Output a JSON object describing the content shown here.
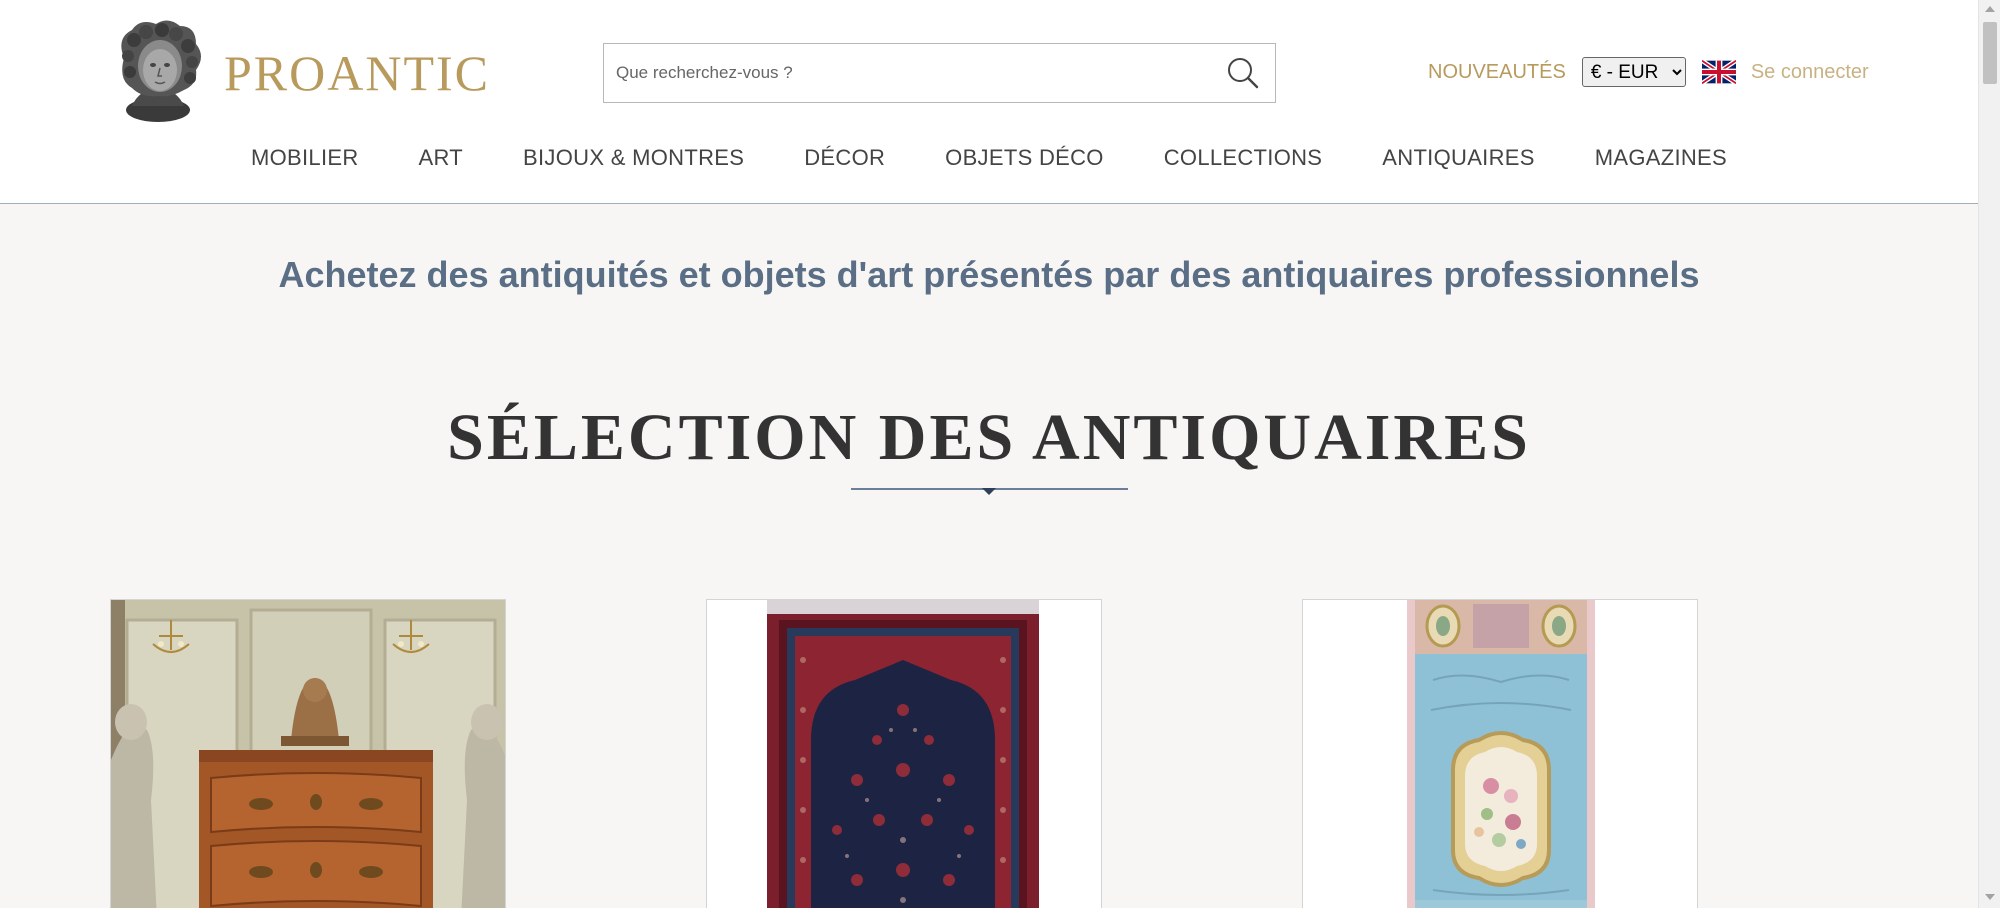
{
  "header": {
    "logo_text": "PROANTIC",
    "search": {
      "placeholder": "Que recherchez-vous ?"
    },
    "nouveautes_label": "NOUVEAUTÉS",
    "currency_selected": "€ - EUR",
    "language_icon": "uk-flag-icon",
    "login_label": "Se connecter"
  },
  "nav": {
    "items": [
      {
        "label": "MOBILIER"
      },
      {
        "label": "ART"
      },
      {
        "label": "BIJOUX & MONTRES"
      },
      {
        "label": "DÉCOR"
      },
      {
        "label": "OBJETS DÉCO"
      },
      {
        "label": "COLLECTIONS"
      },
      {
        "label": "ANTIQUAIRES"
      },
      {
        "label": "MAGAZINES"
      }
    ]
  },
  "main": {
    "tagline": "Achetez des antiquités et objets d'art présentés par des antiquaires professionnels",
    "section_title": "SÉLECTION DES ANTIQUAIRES",
    "cards": [
      {
        "image": "commode-with-cherub-statues-photo"
      },
      {
        "image": "persian-prayer-rug-photo"
      },
      {
        "image": "blue-aubusson-tapestry-photo"
      }
    ]
  },
  "colors": {
    "gold": "#b89a5d",
    "login_gold": "#c8b283",
    "tagline_blue": "#5a6e86",
    "rule_blue": "#6b7f99",
    "page_bg": "#f7f6f4"
  }
}
